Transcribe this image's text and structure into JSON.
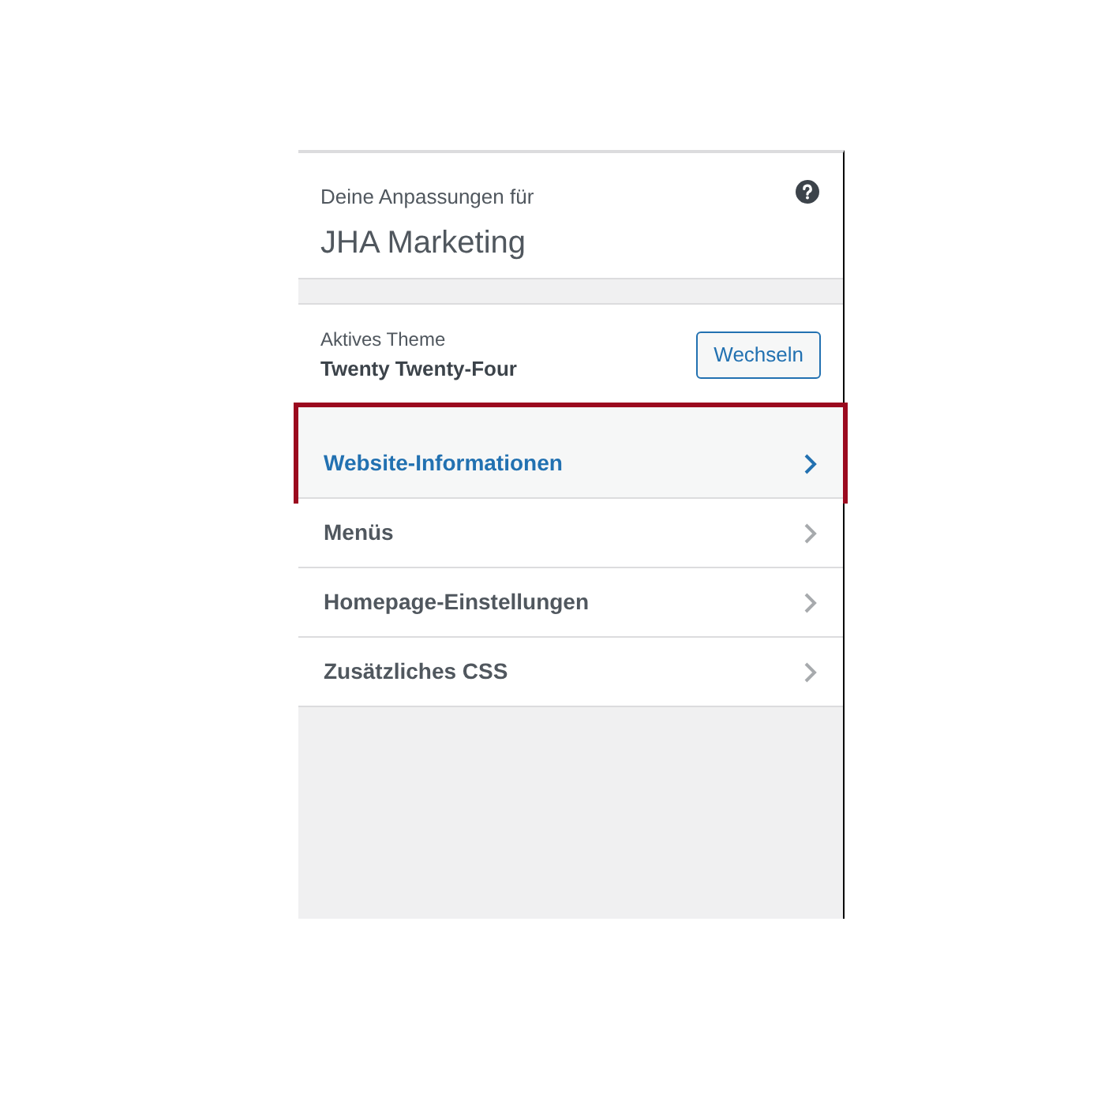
{
  "header": {
    "subtitle": "Deine Anpassungen für",
    "title": "JHA Marketing"
  },
  "theme": {
    "label": "Aktives Theme",
    "name": "Twenty Twenty-Four",
    "button": "Wechseln"
  },
  "menu": [
    {
      "label": "Website-Informationen",
      "selected": true
    },
    {
      "label": "Menüs",
      "selected": false
    },
    {
      "label": "Homepage-Einstellungen",
      "selected": false
    },
    {
      "label": "Zusätzliches CSS",
      "selected": false
    }
  ]
}
